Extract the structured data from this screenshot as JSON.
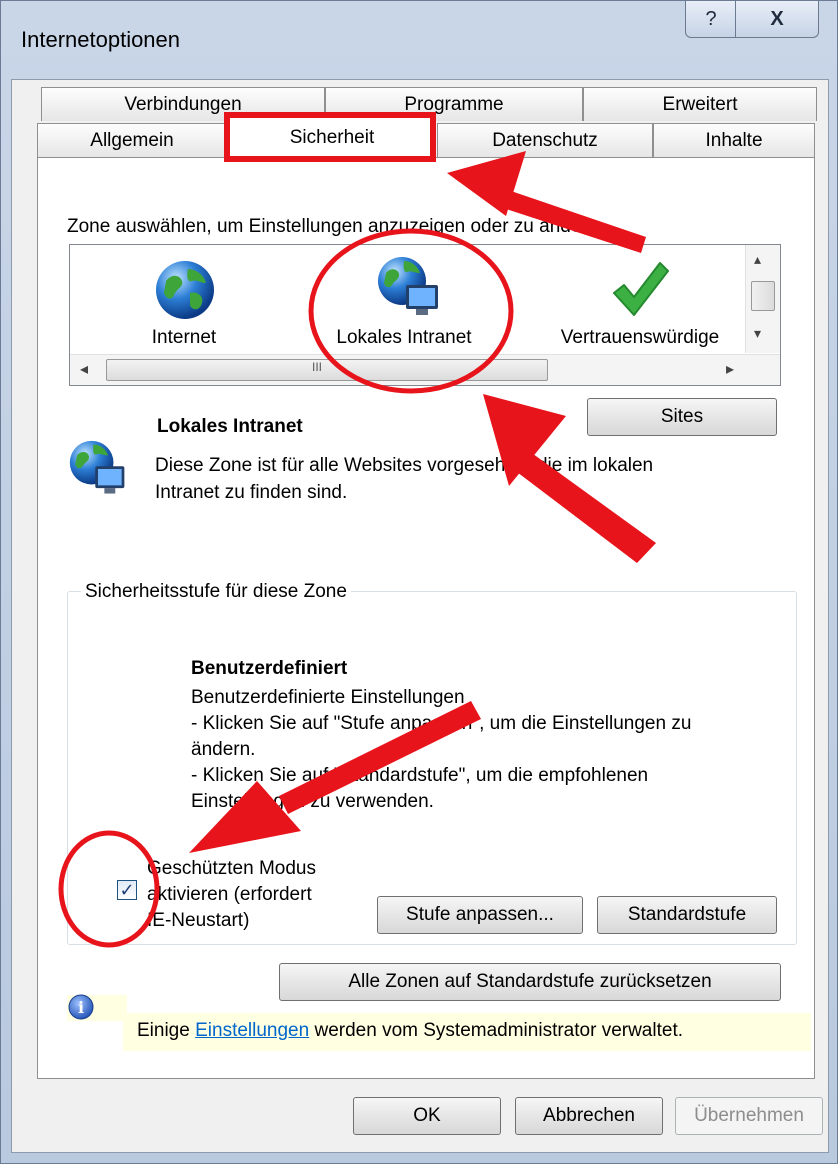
{
  "window": {
    "title": "Internetoptionen",
    "help_label": "?",
    "close_label": "X"
  },
  "tabs": {
    "row1": [
      "Verbindungen",
      "Programme",
      "Erweitert"
    ],
    "row2": [
      "Allgemein",
      "Sicherheit",
      "Datenschutz",
      "Inhalte"
    ],
    "active": "Sicherheit"
  },
  "zones": {
    "prompt": "Zone auswählen, um Einstellungen anzuzeigen oder zu ändern.",
    "items": [
      {
        "label": "Internet",
        "icon": "globe-icon"
      },
      {
        "label": "Lokales Intranet",
        "icon": "intranet-globe-monitor-icon"
      },
      {
        "label": "Vertrauenswürdige",
        "icon": "green-checkmark-icon"
      }
    ],
    "selected": "Lokales Intranet",
    "scroll_left_glyph": "◂",
    "scroll_right_glyph": "▸",
    "scroll_up_glyph": "▴",
    "scroll_down_glyph": "▾",
    "scroll_grip_glyph": "III"
  },
  "zone_info": {
    "title": "Lokales Intranet",
    "description_line1": "Diese Zone ist für alle Websites vorgesehen, die im lokalen",
    "description_line2": "Intranet zu finden sind.",
    "sites_button": "Sites"
  },
  "security_level": {
    "group_label": "Sicherheitsstufe für diese Zone",
    "level_title": "Benutzerdefiniert",
    "lines": [
      "Benutzerdefinierte Einstellungen",
      "- Klicken Sie auf \"Stufe anpassen\", um die Einstellungen zu",
      "ändern.",
      "- Klicken Sie auf \"Standardstufe\", um die empfohlenen",
      "Einstellungen zu verwenden."
    ],
    "protected_mode_lines": [
      "Geschützten Modus",
      "aktivieren (erfordert",
      "IE-Neustart)"
    ],
    "protected_mode_checked": true,
    "checkmark_glyph": "✓",
    "customize_button": "Stufe anpassen...",
    "default_button": "Standardstufe"
  },
  "reset_all_button": "Alle Zonen auf Standardstufe zurücksetzen",
  "admin_notice": {
    "prefix": "Einige ",
    "link": "Einstellungen",
    "suffix": " werden vom Systemadministrator verwaltet.",
    "icon": "info-icon",
    "icon_glyph": "i"
  },
  "footer": {
    "ok": "OK",
    "cancel": "Abbrechen",
    "apply": "Übernehmen"
  },
  "colors": {
    "annotation_red": "#e8141b",
    "checkmark_green": "#3cb043",
    "info_blue": "#2f62c8"
  }
}
